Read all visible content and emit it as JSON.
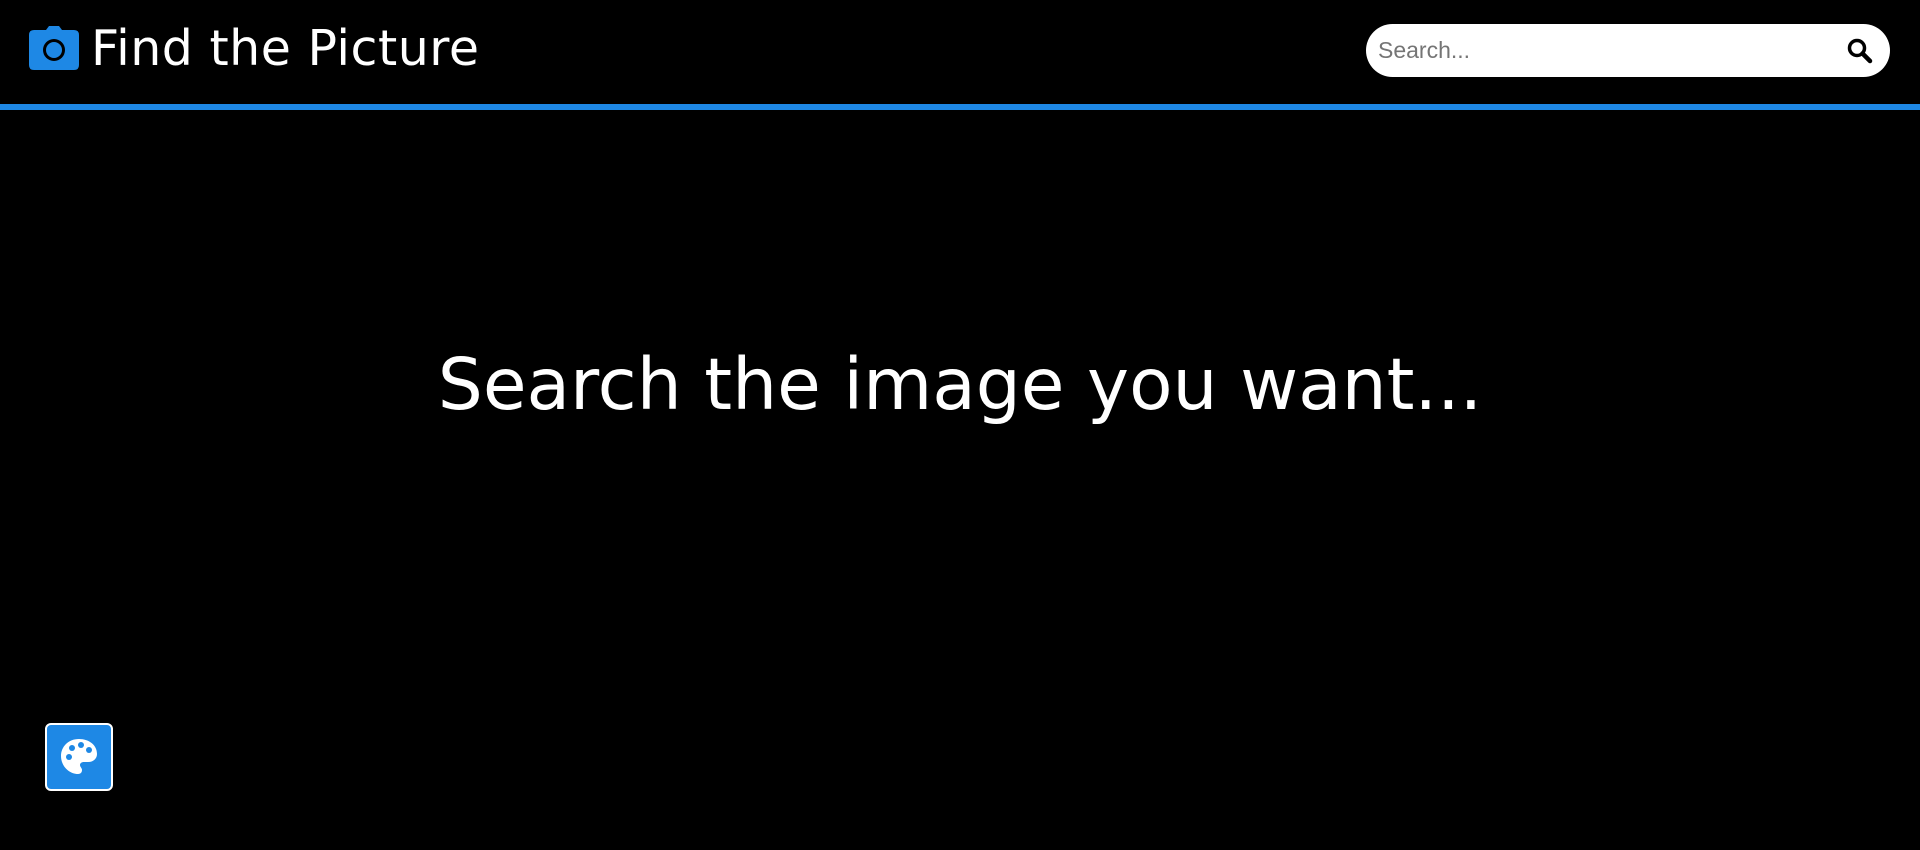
{
  "header": {
    "brand_icon": "camera-icon",
    "brand_title": "Find the Picture",
    "search": {
      "placeholder": "Search...",
      "value": "",
      "button_icon": "search-icon"
    }
  },
  "main": {
    "hero_text": "Search the image you want..."
  },
  "theme_toggle": {
    "icon": "palette-icon"
  },
  "colors": {
    "background": "#000000",
    "accent": "#1e88e5",
    "text": "#ffffff",
    "search_background": "#ffffff"
  }
}
